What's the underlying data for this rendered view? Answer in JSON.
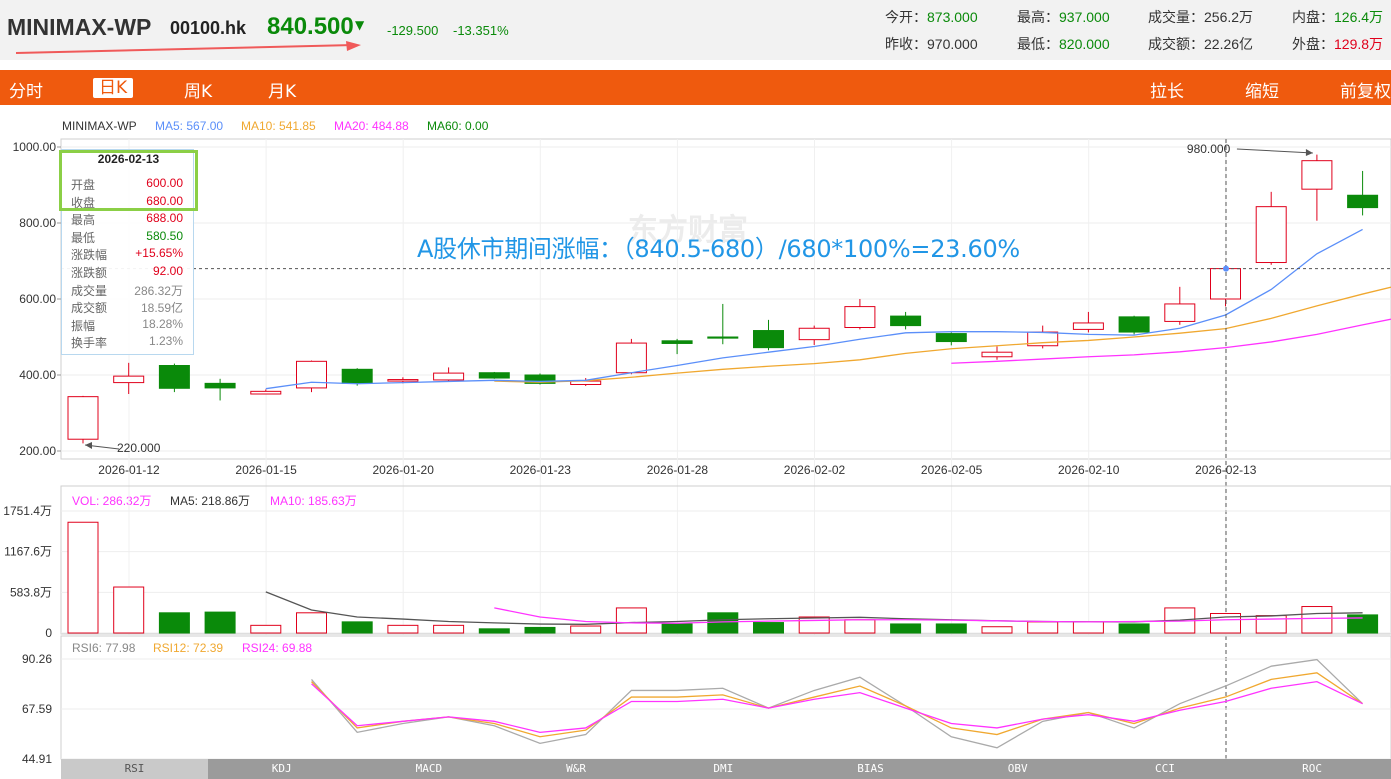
{
  "header": {
    "name": "MINIMAX-WP",
    "code": "00100.hk",
    "price": "840.500",
    "arrow": "▼",
    "change": "-129.500",
    "change_pct": "-13.351%",
    "stats": [
      {
        "label": "今开：",
        "value": "873.000",
        "color": "green"
      },
      {
        "label": "最高：",
        "value": "937.000",
        "color": "green"
      },
      {
        "label": "成交量：",
        "value": "256.2万",
        "color": "dark"
      },
      {
        "label": "内盘：",
        "value": "126.4万",
        "color": "green"
      },
      {
        "label": "昨收：",
        "value": "970.000",
        "color": "dark"
      },
      {
        "label": "最低：",
        "value": "820.000",
        "color": "green"
      },
      {
        "label": "成交额：",
        "value": "22.26亿",
        "color": "dark"
      },
      {
        "label": "外盘：",
        "value": "129.8万",
        "color": "red"
      }
    ]
  },
  "nav": {
    "tabs": [
      "分时",
      "日K",
      "周K",
      "月K"
    ],
    "active": "日K",
    "right": [
      "拉长",
      "缩短",
      "前复权"
    ]
  },
  "legend": {
    "name": "MINIMAX-WP",
    "ma5": "MA5: 567.00",
    "ma10": "MA10: 541.85",
    "ma20": "MA20: 484.88",
    "ma60": "MA60: 0.00"
  },
  "vol_legend": {
    "vol": "VOL: 286.32万",
    "ma5": "MA5: 218.86万",
    "ma10": "MA10: 185.63万"
  },
  "rsi_legend": {
    "rsi6": "RSI6: 77.98",
    "rsi12": "RSI12: 72.39",
    "rsi24": "RSI24: 69.88"
  },
  "tooltip": {
    "date": "2026-02-13",
    "rows": [
      {
        "k": "开盘",
        "v": "600.00",
        "c": "red"
      },
      {
        "k": "收盘",
        "v": "680.00",
        "c": "red"
      },
      {
        "k": "最高",
        "v": "688.00",
        "c": "red"
      },
      {
        "k": "最低",
        "v": "580.50",
        "c": "green"
      },
      {
        "k": "涨跌幅",
        "v": "+15.65%",
        "c": "red"
      },
      {
        "k": "涨跌额",
        "v": "92.00",
        "c": "red"
      },
      {
        "k": "成交量",
        "v": "286.32万",
        "c": "gray"
      },
      {
        "k": "成交额",
        "v": "18.59亿",
        "c": "gray"
      },
      {
        "k": "振幅",
        "v": "18.28%",
        "c": "gray"
      },
      {
        "k": "换手率",
        "v": "1.23%",
        "c": "gray"
      }
    ]
  },
  "annotation": "A股休市期间涨幅：（840.5-680）/680*100%=23.60%",
  "watermark": "东方财富",
  "indicator_tabs": [
    "RSI",
    "KDJ",
    "MACD",
    "W&R",
    "DMI",
    "BIAS",
    "OBV",
    "CCI",
    "ROC"
  ],
  "indicator_active": "RSI",
  "colors": {
    "up": "#e0001b",
    "down": "#0a8a0a",
    "ma5": "#5b8ff9",
    "ma10": "#f0a830",
    "ma20": "#ff33ff",
    "ma60": "#0a8a0a",
    "accent": "#ef5a0e",
    "annotation": "#2196e6"
  },
  "chart_data": {
    "type": "candlestick",
    "price_axis": {
      "ticks": [
        "1000.00",
        "800.00",
        "600.00",
        "400.00",
        "200.00"
      ],
      "ylim": [
        200,
        1000
      ]
    },
    "date_labels": [
      "2026-01-12",
      "2026-01-15",
      "2026-01-20",
      "2026-01-23",
      "2026-01-28",
      "2026-02-02",
      "2026-02-05",
      "2026-02-10",
      "2026-02-13"
    ],
    "date_label_index": [
      0,
      3,
      6,
      9,
      12,
      15,
      18,
      21,
      24
    ],
    "candles": [
      {
        "o": 231,
        "c": 343,
        "h": 345,
        "l": 220
      },
      {
        "o": 380,
        "c": 397,
        "h": 432,
        "l": 350
      },
      {
        "o": 425,
        "c": 365,
        "h": 430,
        "l": 355
      },
      {
        "o": 378,
        "c": 366,
        "h": 390,
        "l": 333
      },
      {
        "o": 350,
        "c": 357,
        "h": 362,
        "l": 350
      },
      {
        "o": 366,
        "c": 436,
        "h": 438,
        "l": 355
      },
      {
        "o": 415,
        "c": 378,
        "h": 418,
        "l": 372
      },
      {
        "o": 384,
        "c": 388,
        "h": 394,
        "l": 378
      },
      {
        "o": 387,
        "c": 405,
        "h": 420,
        "l": 383
      },
      {
        "o": 406,
        "c": 392,
        "h": 408,
        "l": 390
      },
      {
        "o": 400,
        "c": 378,
        "h": 404,
        "l": 375
      },
      {
        "o": 375,
        "c": 384,
        "h": 392,
        "l": 371
      },
      {
        "o": 406,
        "c": 484,
        "h": 495,
        "l": 402
      },
      {
        "o": 490,
        "c": 483,
        "h": 495,
        "l": 455
      },
      {
        "o": 500,
        "c": 497,
        "h": 587,
        "l": 481
      },
      {
        "o": 517,
        "c": 472,
        "h": 545,
        "l": 465
      },
      {
        "o": 493,
        "c": 523,
        "h": 530,
        "l": 479
      },
      {
        "o": 525,
        "c": 580,
        "h": 600,
        "l": 520
      },
      {
        "o": 555,
        "c": 530,
        "h": 566,
        "l": 520
      },
      {
        "o": 509,
        "c": 488,
        "h": 512,
        "l": 478
      },
      {
        "o": 448,
        "c": 460,
        "h": 475,
        "l": 440
      },
      {
        "o": 477,
        "c": 513,
        "h": 530,
        "l": 470
      },
      {
        "o": 520,
        "c": 537,
        "h": 566,
        "l": 512
      },
      {
        "o": 553,
        "c": 513,
        "h": 556,
        "l": 507
      },
      {
        "o": 541,
        "c": 587,
        "h": 632,
        "l": 532
      },
      {
        "o": 600,
        "c": 680,
        "h": 688,
        "l": 580.5
      },
      {
        "o": 696,
        "c": 843,
        "h": 882,
        "l": 690
      },
      {
        "o": 889,
        "c": 964,
        "h": 980,
        "l": 806
      },
      {
        "o": 873,
        "c": 840.5,
        "h": 937,
        "l": 820
      }
    ],
    "ma5": [
      null,
      null,
      null,
      null,
      364,
      381,
      377,
      380,
      383,
      386,
      383,
      386,
      406,
      425,
      445,
      460,
      475,
      494,
      511,
      514,
      514,
      512,
      507,
      505,
      523,
      558,
      625,
      719,
      783
    ],
    "ma10": [
      null,
      null,
      null,
      null,
      null,
      null,
      null,
      null,
      null,
      384,
      381,
      385,
      394,
      405,
      415,
      423,
      430,
      440,
      457,
      469,
      477,
      485,
      491,
      500,
      510,
      522,
      549,
      582,
      613,
      642
    ],
    "ma20": [
      null,
      null,
      null,
      null,
      null,
      null,
      null,
      null,
      null,
      null,
      null,
      null,
      null,
      null,
      null,
      null,
      null,
      null,
      null,
      431,
      436,
      442,
      448,
      453,
      461,
      472,
      487,
      507,
      532,
      556
    ],
    "annotated_high": "980.000",
    "annotated_low": "220.000",
    "volume_axis": {
      "ticks": [
        "1751.4万",
        "1167.6万",
        "583.8万",
        "0"
      ],
      "ylim": [
        0,
        1751.4
      ]
    },
    "volume": [
      1590,
      660,
      290,
      300,
      110,
      290,
      160,
      110,
      110,
      60,
      80,
      100,
      360,
      130,
      290,
      150,
      230,
      190,
      130,
      130,
      90,
      160,
      160,
      130,
      360,
      280,
      250,
      380,
      260
    ],
    "vol_ma5": [
      null,
      null,
      null,
      null,
      590,
      330,
      230,
      200,
      165,
      145,
      128,
      125,
      150,
      165,
      190,
      205,
      215,
      225,
      205,
      190,
      175,
      165,
      160,
      160,
      185,
      230,
      245,
      280,
      290
    ],
    "vol_ma10": [
      null,
      null,
      null,
      null,
      null,
      null,
      null,
      null,
      null,
      360,
      230,
      165,
      145,
      140,
      160,
      170,
      180,
      190,
      190,
      185,
      175,
      165,
      160,
      165,
      170,
      190,
      200,
      210,
      216
    ],
    "rsi_axis": {
      "ticks": [
        "90.26",
        "67.59",
        "44.91"
      ],
      "ylim": [
        44.91,
        90.26
      ]
    },
    "rsi6": [
      null,
      null,
      null,
      null,
      null,
      81,
      57,
      61,
      64,
      60,
      52,
      56,
      76,
      76,
      77,
      68,
      76,
      82,
      69,
      55,
      50,
      62,
      66,
      59,
      70,
      78,
      87,
      90,
      70
    ],
    "rsi12": [
      null,
      null,
      null,
      null,
      null,
      80,
      59,
      62,
      64,
      61,
      55,
      58,
      73,
      73,
      74,
      68,
      73,
      78,
      69,
      59,
      56,
      63,
      66,
      61,
      68,
      73,
      81,
      84,
      70
    ],
    "rsi24": [
      null,
      null,
      null,
      null,
      null,
      79,
      60,
      62,
      64,
      62,
      57,
      59,
      71,
      71,
      72,
      68,
      72,
      75,
      68,
      61,
      59,
      63,
      65,
      62,
      67,
      71,
      77,
      80,
      70
    ]
  }
}
